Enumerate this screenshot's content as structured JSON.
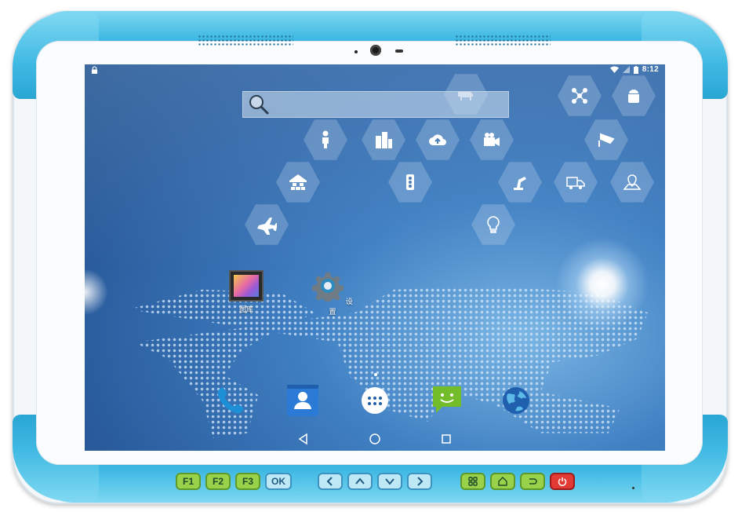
{
  "device": {
    "hardware_keys": {
      "f1": "F1",
      "f2": "F2",
      "f3": "F3",
      "ok": "OK"
    }
  },
  "status_bar": {
    "time": "8:12"
  },
  "home_apps": {
    "gallery": "图库",
    "settings": "设置"
  },
  "colors": {
    "bumper": "#3fb9e3",
    "key_green": "#9ad14a",
    "key_blue": "#bfe8f6",
    "key_red": "#e23a34"
  }
}
